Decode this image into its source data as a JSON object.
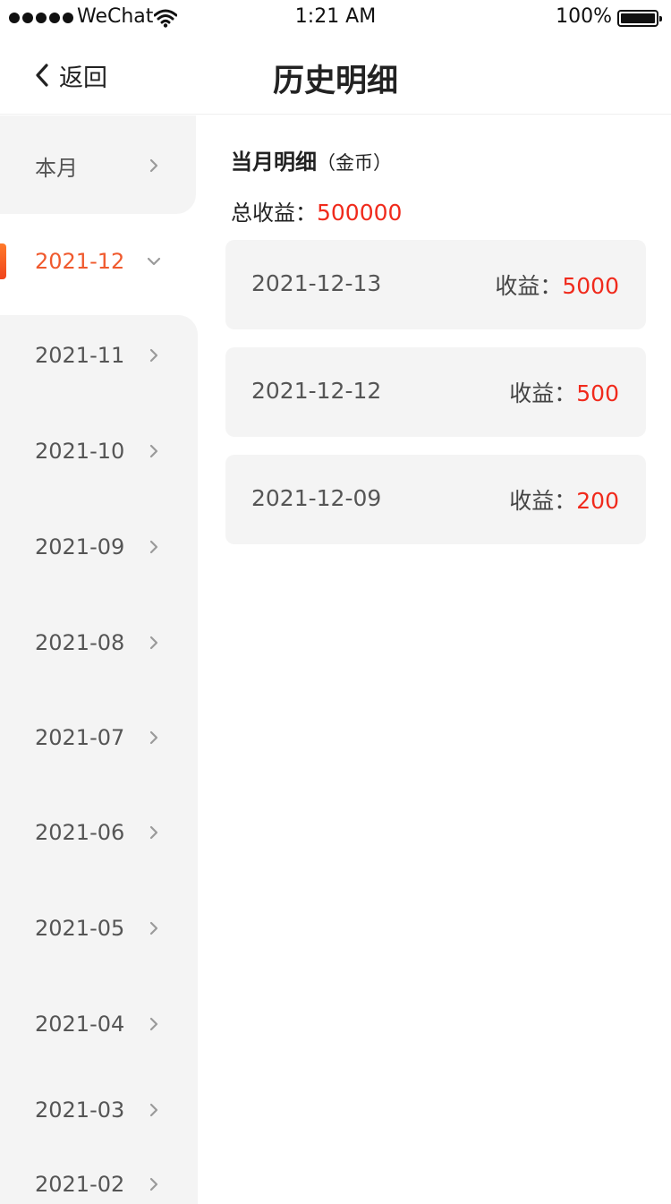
{
  "status_bar": {
    "carrier": "WeChat",
    "time": "1:21 AM",
    "battery": "100%"
  },
  "nav": {
    "back_label": "返回",
    "title": "历史明细"
  },
  "sidebar": {
    "items": [
      {
        "label": "本月",
        "state": "collapsed"
      },
      {
        "label": "2021-12",
        "state": "expanded"
      },
      {
        "label": "2021-11",
        "state": "collapsed"
      },
      {
        "label": "2021-10",
        "state": "collapsed"
      },
      {
        "label": "2021-09",
        "state": "collapsed"
      },
      {
        "label": "2021-08",
        "state": "collapsed"
      },
      {
        "label": "2021-07",
        "state": "collapsed"
      },
      {
        "label": "2021-06",
        "state": "collapsed"
      },
      {
        "label": "2021-05",
        "state": "collapsed"
      },
      {
        "label": "2021-04",
        "state": "collapsed"
      },
      {
        "label": "2021-03",
        "state": "collapsed"
      },
      {
        "label": "2021-02",
        "state": "collapsed"
      }
    ]
  },
  "detail": {
    "title": "当月明细",
    "unit": "（金币）",
    "total_label": "总收益：",
    "total_value": "500000",
    "income_label": "收益：",
    "records": [
      {
        "date": "2021-12-13",
        "value": "5000"
      },
      {
        "date": "2021-12-12",
        "value": "500"
      },
      {
        "date": "2021-12-09",
        "value": "200"
      }
    ]
  },
  "colors": {
    "accent": "#f05a2e",
    "value_red": "#f02a1c",
    "panel_bg": "#f4f4f4"
  }
}
